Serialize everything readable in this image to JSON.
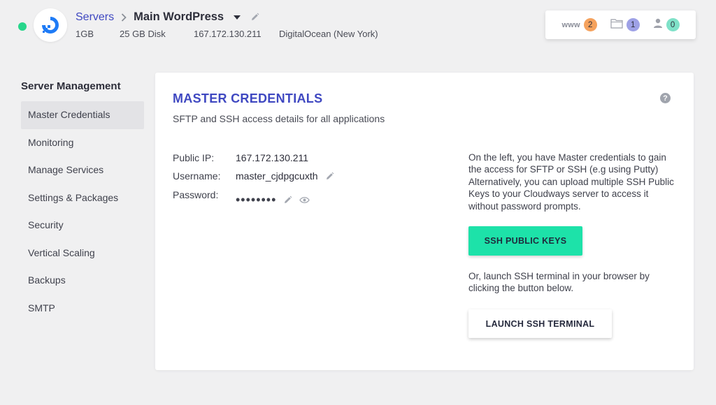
{
  "header": {
    "status_color": "#27d68b",
    "provider_logo_icon": "digitalocean-logo-icon",
    "breadcrumb": {
      "parent": "Servers",
      "current": "Main WordPress"
    },
    "server": {
      "size": "1GB",
      "disk": "25 GB Disk",
      "ip": "167.172.130.211",
      "location": "DigitalOcean (New York)"
    },
    "counts": [
      {
        "label": "www",
        "icon": "www-icon",
        "value": "2",
        "color": "#f5a25d"
      },
      {
        "label": "",
        "icon": "folder-icon",
        "value": "1",
        "color": "#9ea1e6"
      },
      {
        "label": "",
        "icon": "user-icon",
        "value": "0",
        "color": "#7fe1c8"
      }
    ]
  },
  "sidebar": {
    "title": "Server Management",
    "items": [
      {
        "label": "Master Credentials",
        "active": true
      },
      {
        "label": "Monitoring"
      },
      {
        "label": "Manage Services"
      },
      {
        "label": "Settings & Packages"
      },
      {
        "label": "Security"
      },
      {
        "label": "Vertical Scaling"
      },
      {
        "label": "Backups"
      },
      {
        "label": "SMTP"
      }
    ]
  },
  "main": {
    "title": "MASTER CREDENTIALS",
    "subtitle": "SFTP and SSH access details for all applications",
    "help_icon": "?",
    "credentials": {
      "public_ip_label": "Public IP:",
      "public_ip": "167.172.130.211",
      "username_label": "Username:",
      "username": "master_cjdpgcuxth",
      "password_label": "Password:",
      "password_mask": "••••••••"
    },
    "info_text": "On the left, you have Master credentials to gain the access for SFTP or SSH (e.g using Putty) Alternatively, you can upload multiple SSH Public Keys to your Cloudways server to access it without password prompts.",
    "ssh_keys_button": "SSH PUBLIC KEYS",
    "terminal_text": "Or, launch SSH terminal in your browser by clicking the button below.",
    "terminal_button": "LAUNCH SSH TERMINAL",
    "accent_color": "#3f48c1",
    "primary_button_color": "#1de2a9"
  }
}
